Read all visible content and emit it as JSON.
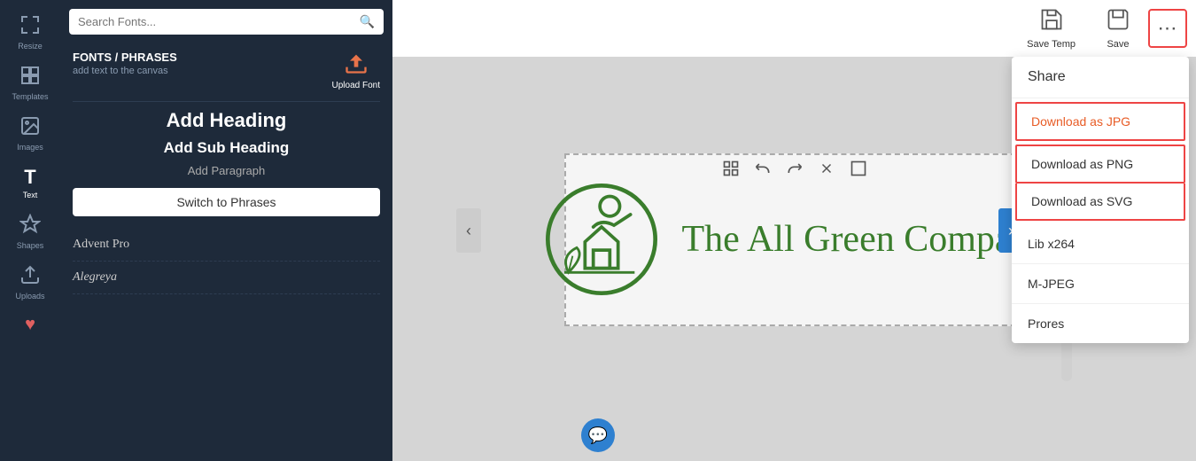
{
  "header": {
    "save_temp_label": "Save Temp",
    "save_label": "Save",
    "more_icon": "⋯"
  },
  "dropdown": {
    "items": [
      {
        "id": "share",
        "label": "Share",
        "highlighted": false
      },
      {
        "id": "download-jpg",
        "label": "Download as JPG",
        "highlighted": true
      },
      {
        "id": "download-png",
        "label": "Download as PNG",
        "highlighted": true
      },
      {
        "id": "download-svg",
        "label": "Download as SVG",
        "highlighted": true
      },
      {
        "id": "lib-x264",
        "label": "Lib x264",
        "highlighted": false
      },
      {
        "id": "m-jpeg",
        "label": "M-JPEG",
        "highlighted": false
      },
      {
        "id": "prores",
        "label": "Prores",
        "highlighted": false
      }
    ]
  },
  "sidebar": {
    "items": [
      {
        "id": "resize",
        "label": "Resize",
        "icon": "⤢"
      },
      {
        "id": "templates",
        "label": "Templates",
        "icon": "⊞"
      },
      {
        "id": "images",
        "label": "Images",
        "icon": "🖼"
      },
      {
        "id": "text",
        "label": "Text",
        "icon": "T",
        "active": true
      },
      {
        "id": "shapes",
        "label": "Shapes",
        "icon": "✦"
      },
      {
        "id": "uploads",
        "label": "Uploads",
        "icon": "⬆"
      },
      {
        "id": "favorites",
        "label": "",
        "icon": "♥"
      }
    ]
  },
  "panel": {
    "search_placeholder": "Search Fonts...",
    "section_title": "FONTS / PHRASES",
    "section_subtitle": "add text to the canvas",
    "upload_font_label": "Upload Font",
    "add_heading": "Add Heading",
    "add_subheading": "Add Sub Heading",
    "add_paragraph": "Add Paragraph",
    "switch_btn": "Switch to Phrases",
    "fonts": [
      {
        "name": "Advent Pro"
      },
      {
        "name": "Alegreya"
      }
    ]
  },
  "canvas": {
    "logo_text": "The All Green Company",
    "toolbar_icons": [
      "⊞",
      "↩",
      "↪",
      "✕",
      "⊡"
    ]
  }
}
